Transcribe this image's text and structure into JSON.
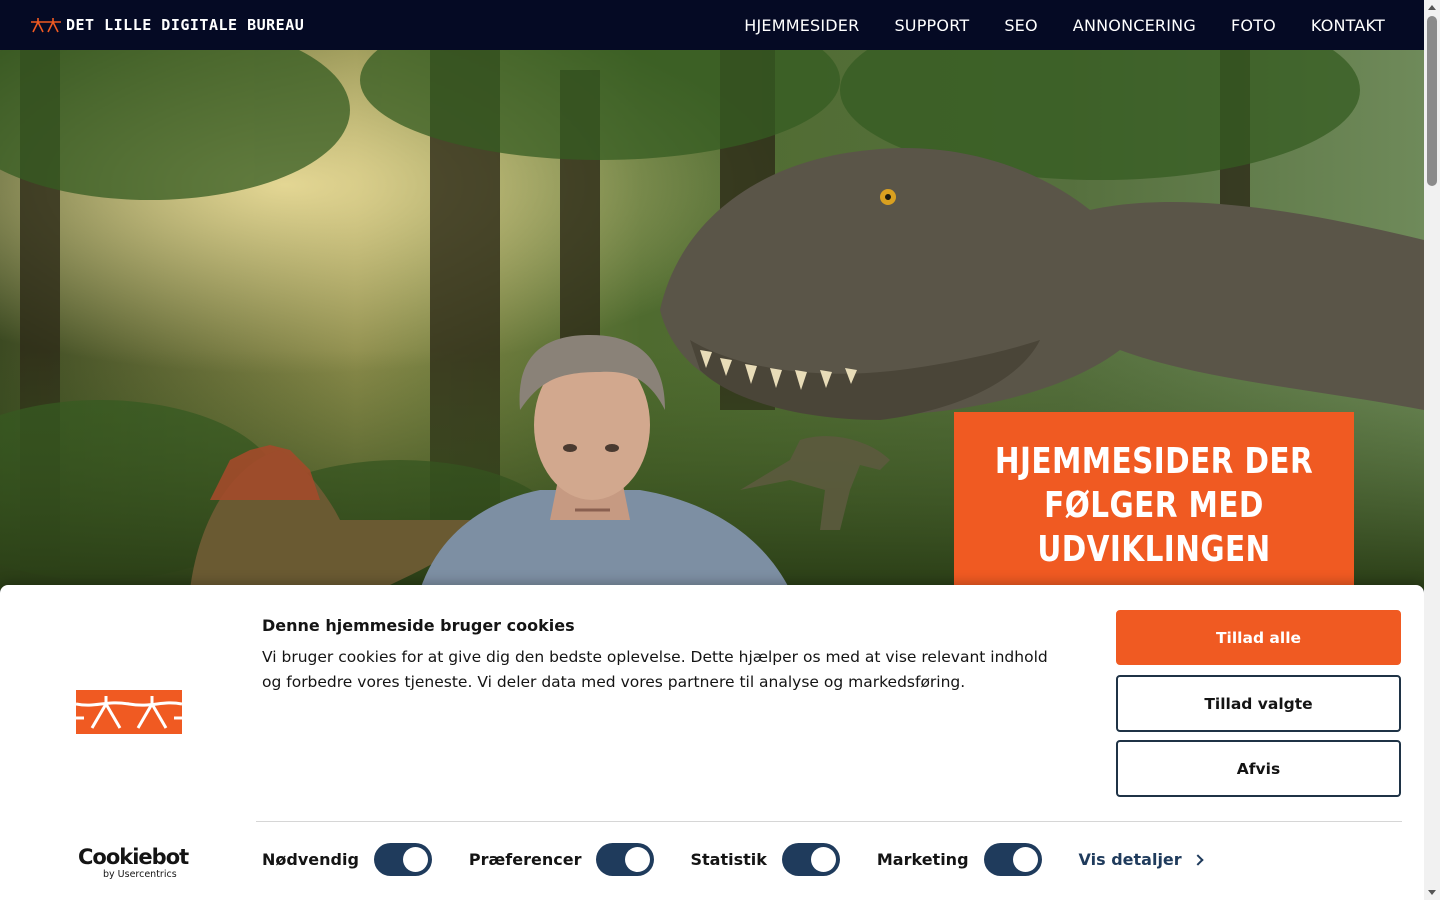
{
  "header": {
    "brand": "DET LILLE DIGITALE BUREAU",
    "nav": [
      "HJEMMESIDER",
      "SUPPORT",
      "SEO",
      "ANNONCERING",
      "FOTO",
      "KONTAKT"
    ]
  },
  "hero": {
    "title": "HJEMMESIDER DER FØLGER MED UDVIKLINGEN"
  },
  "cookie": {
    "title": "Denne hjemmeside bruger cookies",
    "text": "Vi bruger cookies for at give dig den bedste oplevelse. Dette hjælper os med at vise relevant indhold og forbedre vores tjeneste. Vi deler data med vores partnere til analyse og markedsføring.",
    "allow_all": "Tillad alle",
    "allow_selected": "Tillad valgte",
    "reject": "Afvis",
    "toggles": [
      {
        "label": "Nødvendig",
        "on": true
      },
      {
        "label": "Præferencer",
        "on": true
      },
      {
        "label": "Statistik",
        "on": true
      },
      {
        "label": "Marketing",
        "on": true
      }
    ],
    "details": "Vis detaljer",
    "provider": "Cookiebot",
    "provider_sub": "by Usercentrics"
  },
  "colors": {
    "accent": "#f05a22",
    "header_bg": "#050a24",
    "toggle_on": "#1f3b5c"
  }
}
